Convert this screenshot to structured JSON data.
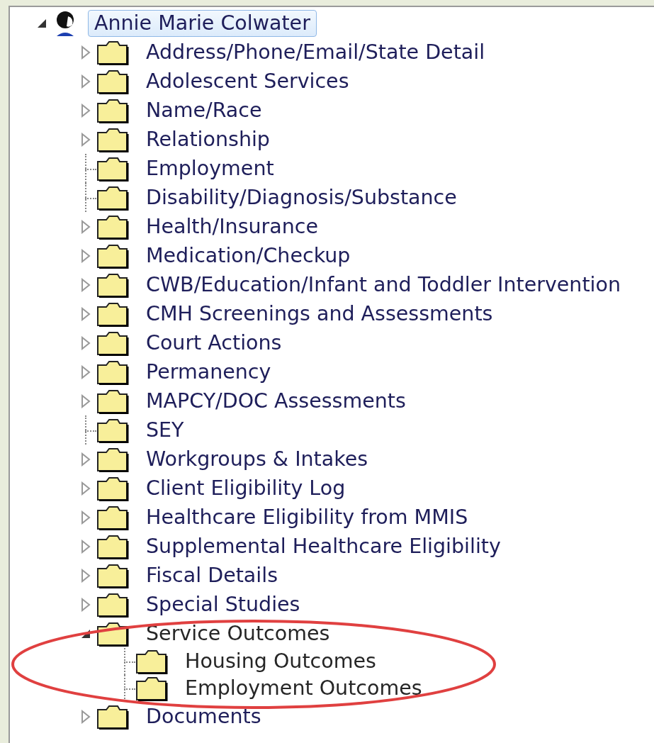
{
  "tree": {
    "label": "Annie Marie Colwater",
    "selected": true,
    "expanded": true,
    "children": [
      {
        "label": "Address/Phone/Email/State Detail",
        "kind": "branch",
        "expanded": false,
        "selected": false
      },
      {
        "label": "Adolescent Services",
        "kind": "branch",
        "expanded": false,
        "selected": false
      },
      {
        "label": "Name/Race",
        "kind": "branch",
        "expanded": false,
        "selected": false
      },
      {
        "label": "Relationship",
        "kind": "branch",
        "expanded": false,
        "selected": false
      },
      {
        "label": "Employment",
        "kind": "leaf",
        "selected": false
      },
      {
        "label": "Disability/Diagnosis/Substance",
        "kind": "leaf",
        "selected": false
      },
      {
        "label": "Health/Insurance",
        "kind": "branch",
        "expanded": false,
        "selected": false
      },
      {
        "label": "Medication/Checkup",
        "kind": "branch",
        "expanded": false,
        "selected": false
      },
      {
        "label": "CWB/Education/Infant and Toddler Intervention",
        "kind": "branch",
        "expanded": false,
        "selected": false
      },
      {
        "label": "CMH Screenings and Assessments",
        "kind": "branch",
        "expanded": false,
        "selected": false
      },
      {
        "label": "Court Actions",
        "kind": "branch",
        "expanded": false,
        "selected": false
      },
      {
        "label": "Permanency",
        "kind": "branch",
        "expanded": false,
        "selected": false
      },
      {
        "label": "MAPCY/DOC Assessments",
        "kind": "branch",
        "expanded": false,
        "selected": false
      },
      {
        "label": "SEY",
        "kind": "leaf",
        "selected": false
      },
      {
        "label": "Workgroups & Intakes",
        "kind": "branch",
        "expanded": false,
        "selected": false
      },
      {
        "label": "Client Eligibility Log",
        "kind": "branch",
        "expanded": false,
        "selected": false
      },
      {
        "label": "Healthcare Eligibility from MMIS",
        "kind": "branch",
        "expanded": false,
        "selected": false
      },
      {
        "label": "Supplemental Healthcare Eligibility",
        "kind": "branch",
        "expanded": false,
        "selected": false
      },
      {
        "label": "Fiscal Details",
        "kind": "branch",
        "expanded": false,
        "selected": false
      },
      {
        "label": "Special Studies",
        "kind": "branch",
        "expanded": false,
        "selected": false
      },
      {
        "label": "Service Outcomes",
        "kind": "branch",
        "expanded": true,
        "selected": false,
        "children": [
          {
            "label": "Housing Outcomes",
            "kind": "leaf",
            "selected": false
          },
          {
            "label": "Employment Outcomes",
            "kind": "leaf",
            "selected": false
          }
        ]
      },
      {
        "label": "Documents",
        "kind": "branch",
        "expanded": false,
        "selected": false
      }
    ]
  },
  "annotation": {
    "kind": "ellipse",
    "color": "#e04040"
  }
}
